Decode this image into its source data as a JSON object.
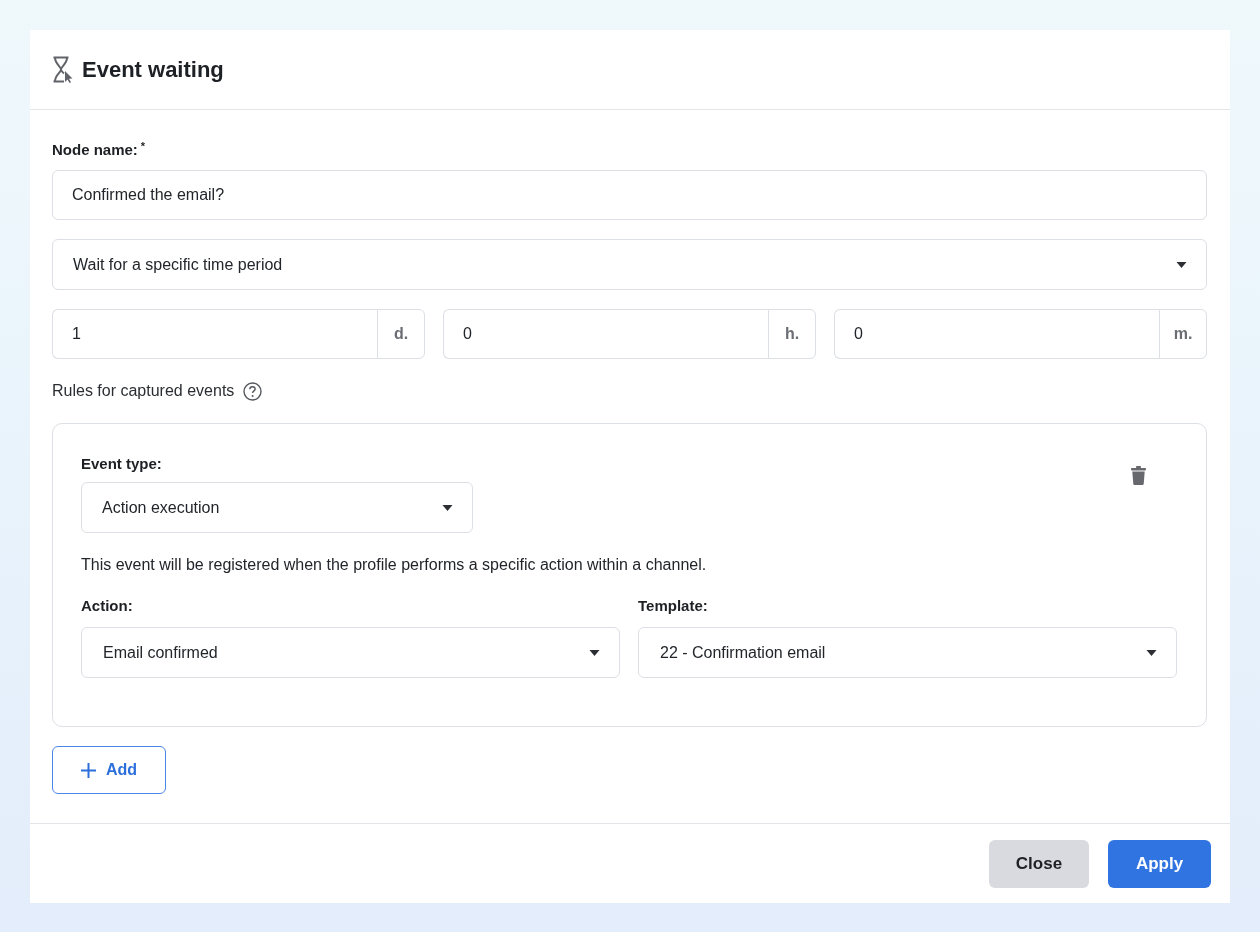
{
  "dialog": {
    "title": "Event waiting"
  },
  "node_name": {
    "label": "Node name:",
    "required_mark": "*",
    "value": "Confirmed the email?"
  },
  "wait_mode": {
    "value": "Wait for a specific time period"
  },
  "duration": [
    {
      "value": "1",
      "unit": "d."
    },
    {
      "value": "0",
      "unit": "h."
    },
    {
      "value": "0",
      "unit": "m."
    }
  ],
  "rules": {
    "label": "Rules for captured events",
    "items": [
      {
        "event_type_label": "Event type:",
        "event_type": "Action execution",
        "description": "This event will be registered when the profile performs a specific action within a channel.",
        "fields": [
          {
            "label": "Action:",
            "value": "Email confirmed"
          },
          {
            "label": "Template:",
            "value": "22 - Confirmation email"
          }
        ]
      }
    ]
  },
  "add_button": {
    "label": "Add"
  },
  "buttons": [
    {
      "label": "Close",
      "kind": "secondary"
    },
    {
      "label": "Apply",
      "kind": "primary"
    }
  ]
}
